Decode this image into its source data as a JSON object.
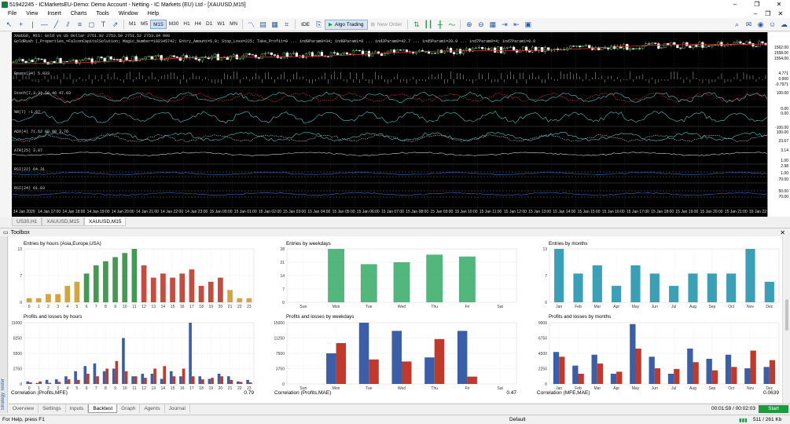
{
  "window": {
    "title": "51942245 - ICMarketsEU-Demo: Demo Account - Netting - IC Markets (EU) Ltd - [XAUUSD,M15]",
    "minimize": "–",
    "maximize": "❐",
    "close": "✕"
  },
  "menu": {
    "items": [
      "File",
      "View",
      "Insert",
      "Charts",
      "Tools",
      "Window",
      "Help"
    ]
  },
  "toolbar": {
    "timeframes": [
      "M1",
      "M5",
      "M15",
      "M30",
      "H1",
      "H4",
      "D1",
      "W1",
      "MN"
    ],
    "active_timeframe": "M15",
    "ide_label": "IDE",
    "algo_trading_label": "Algo Trading",
    "new_order_label": "New Order"
  },
  "chart": {
    "symbol_line": "XAUUSD, M15:  Gold vs US Dollar  2751.92 2753.50 2751.52 2753.34  990",
    "ea_line": "GoldRush (_Properties_=FalconCapitalSolution; Magic_Number=192345742; Entry_Amount=5.0; Stop_Loss=225; Take_Profit=0 ... ind0Param0=34; ind0Param1=0 ... ind2Param0=42.7 ... ind5Param1=20.0 ... ind7Param0=4; ind7Param1=0.0",
    "indicators": [
      "Bears(34) 5.033",
      "Stoch(7,3,3) 58.46 47.83",
      "%R(7) -1.67",
      "ADX(4) 71.52 60.90 3.76",
      "ATR(25) 3.07",
      "RSI(22) 64.31",
      "RSI(24) 61.83"
    ],
    "price_labels": [
      "1562.00",
      "1558.00",
      "1554.00",
      "4.771",
      "0.000",
      "-0.7971",
      "100.00",
      "0.00",
      "0.00",
      "-100.00",
      "100.00",
      "23.67",
      "3.14",
      "1.00",
      "2.98",
      "1.00",
      "70.00",
      "50.00",
      "70.00"
    ],
    "time_labels": [
      "14 Jan 2020",
      "14 Jan 17:00",
      "14 Jan 18:00",
      "14 Jan 19:00",
      "14 Jan 20:00",
      "14 Jan 21:00",
      "14 Jan 22:00",
      "14 Jan 23:00",
      "15 Jan 00:00",
      "15 Jan 01:00",
      "15 Jan 02:00",
      "15 Jan 03:00",
      "15 Jan 04:00",
      "15 Jan 05:00",
      "15 Jan 06:00",
      "15 Jan 07:00",
      "15 Jan 08:00",
      "15 Jan 09:00",
      "15 Jan 10:00",
      "15 Jan 11:00",
      "15 Jan 12:00",
      "15 Jan 13:00",
      "15 Jan 14:00",
      "15 Jan 15:00",
      "15 Jan 16:00",
      "15 Jan 17:00",
      "15 Jan 18:00",
      "15 Jan 19:00",
      "15 Jan 20:00",
      "15 Jan 21:00",
      "15 Jan 22:00"
    ],
    "tabs": [
      "US30,H1",
      "XAUUSD,M15",
      "XAUUSD,M15"
    ],
    "active_tab": 2
  },
  "toolbox": {
    "label": "Toolbox",
    "side_label": "Strategy Tester"
  },
  "report": {
    "correlations": [
      {
        "label": "Correlation (Profits,MFE)",
        "value": "0.79"
      },
      {
        "label": "Correlation (Profits,MAE)",
        "value": "0.47"
      },
      {
        "label": "Correlation (MFE,MAE)",
        "value": "0.0639"
      }
    ]
  },
  "chart_data": [
    {
      "type": "bar",
      "title": "Entries by hours (Asia,Europe,USA)",
      "categories": [
        "0",
        "1",
        "2",
        "3",
        "4",
        "5",
        "6",
        "7",
        "8",
        "9",
        "10",
        "11",
        "12",
        "13",
        "14",
        "15",
        "16",
        "17",
        "18",
        "19",
        "20",
        "21",
        "22",
        "23"
      ],
      "values": [
        1,
        1,
        2,
        2,
        4,
        5,
        7,
        9,
        10,
        11,
        12,
        13,
        9,
        6,
        7,
        6,
        7,
        8,
        4,
        5,
        6,
        3,
        1,
        1
      ],
      "colors": [
        "#d09a2e",
        "#d09a2e",
        "#d09a2e",
        "#d09a2e",
        "#d09a2e",
        "#d09a2e",
        "#2f8f3f",
        "#2f8f3f",
        "#2f8f3f",
        "#2f8f3f",
        "#2f8f3f",
        "#2f8f3f",
        "#c0392b",
        "#c0392b",
        "#c0392b",
        "#c0392b",
        "#c0392b",
        "#c0392b",
        "#c0392b",
        "#c0392b",
        "#c0392b",
        "#d09a2e",
        "#d09a2e",
        "#d09a2e"
      ],
      "yticks": [
        "13",
        "7",
        "0"
      ],
      "ylim": [
        0,
        13
      ]
    },
    {
      "type": "bar",
      "title": "Entries by weekdays",
      "categories": [
        "Sun",
        "Mon",
        "Tue",
        "Wed",
        "Thu",
        "Fri",
        "Sat"
      ],
      "values": [
        0,
        28,
        20,
        21,
        25,
        24,
        0
      ],
      "color": "#3fae6f",
      "yticks": [
        "28",
        "21",
        "14",
        "7",
        "0"
      ],
      "ylim": [
        0,
        28
      ]
    },
    {
      "type": "bar",
      "title": "Entries by months",
      "categories": [
        "Jan",
        "Feb",
        "Mar",
        "Apr",
        "May",
        "Jun",
        "Jul",
        "Aug",
        "Sep",
        "Oct",
        "Nov",
        "Dec"
      ],
      "values": [
        13,
        7,
        9,
        4,
        9,
        7,
        4,
        7,
        7,
        7,
        13,
        5
      ],
      "color": "#2596b0",
      "yticks": [
        "13",
        "7",
        "0"
      ],
      "ylim": [
        0,
        13
      ]
    },
    {
      "type": "bar",
      "title": "Profits and losses by hours",
      "categories": [
        "0",
        "1",
        "2",
        "3",
        "4",
        "5",
        "6",
        "7",
        "8",
        "9",
        "10",
        "11",
        "12",
        "13",
        "14",
        "15",
        "16",
        "17",
        "18",
        "19",
        "20",
        "21",
        "22",
        "23"
      ],
      "series": [
        {
          "name": "Profits",
          "values": [
            500,
            200,
            800,
            900,
            1500,
            2500,
            3500,
            4000,
            2500,
            3000,
            9000,
            1500,
            2000,
            2000,
            1000,
            2500,
            1500,
            12000,
            1500,
            1000,
            2000,
            1500,
            500,
            800
          ],
          "color": "#3a5fa8"
        },
        {
          "name": "Losses",
          "values": [
            300,
            500,
            200,
            400,
            900,
            800,
            2000,
            1500,
            3000,
            4500,
            2500,
            1500,
            1200,
            3000,
            3500,
            1500,
            3000,
            1500,
            900,
            1200,
            1500,
            800,
            400,
            300
          ],
          "color": "#c0392b"
        }
      ],
      "yticks": [
        "11000",
        "8250",
        "5500",
        "2750",
        "0"
      ],
      "ylim": [
        0,
        12000
      ]
    },
    {
      "type": "bar",
      "title": "Profits and losses by weekdays",
      "categories": [
        "Sun",
        "Mon",
        "Tue",
        "Wed",
        "Thu",
        "Fri",
        "Sat"
      ],
      "series": [
        {
          "name": "Profits",
          "values": [
            0,
            7500,
            15000,
            13000,
            6500,
            13000,
            0
          ],
          "color": "#3a5fa8"
        },
        {
          "name": "Losses",
          "values": [
            0,
            10000,
            6000,
            5500,
            11000,
            1800,
            0
          ],
          "color": "#c0392b"
        }
      ],
      "yticks": [
        "15000",
        "11250",
        "7500",
        "3750",
        "0"
      ],
      "ylim": [
        0,
        15000
      ]
    },
    {
      "type": "bar",
      "title": "Profits and losses by months",
      "categories": [
        "Jan",
        "Feb",
        "Mar",
        "Apr",
        "May",
        "Jun",
        "Jul",
        "Aug",
        "Sep",
        "Oct",
        "Nov",
        "Dec"
      ],
      "series": [
        {
          "name": "Profits",
          "values": [
            4700,
            2700,
            4300,
            1500,
            8800,
            4000,
            1500,
            5200,
            3700,
            4300,
            2300,
            2500
          ],
          "color": "#3a5fa8"
        },
        {
          "name": "Losses",
          "values": [
            4000,
            1500,
            3000,
            1800,
            5200,
            2300,
            2200,
            3200,
            2000,
            2500,
            4900,
            3500
          ],
          "color": "#c0392b"
        }
      ],
      "yticks": [
        "9000",
        "6750",
        "4500",
        "2250",
        "0"
      ],
      "ylim": [
        0,
        9000
      ]
    }
  ],
  "bottom_tabs": {
    "items": [
      "Overview",
      "Settings",
      "Inputs",
      "Backtest",
      "Graph",
      "Agents",
      "Journal"
    ],
    "active": "Backtest"
  },
  "tester": {
    "timer": "00:01:59 / 00:02:03",
    "start_label": "Start"
  },
  "status": {
    "help": "For Help, press F1",
    "profile": "Default",
    "traffic": "511 / 261 Kb"
  }
}
